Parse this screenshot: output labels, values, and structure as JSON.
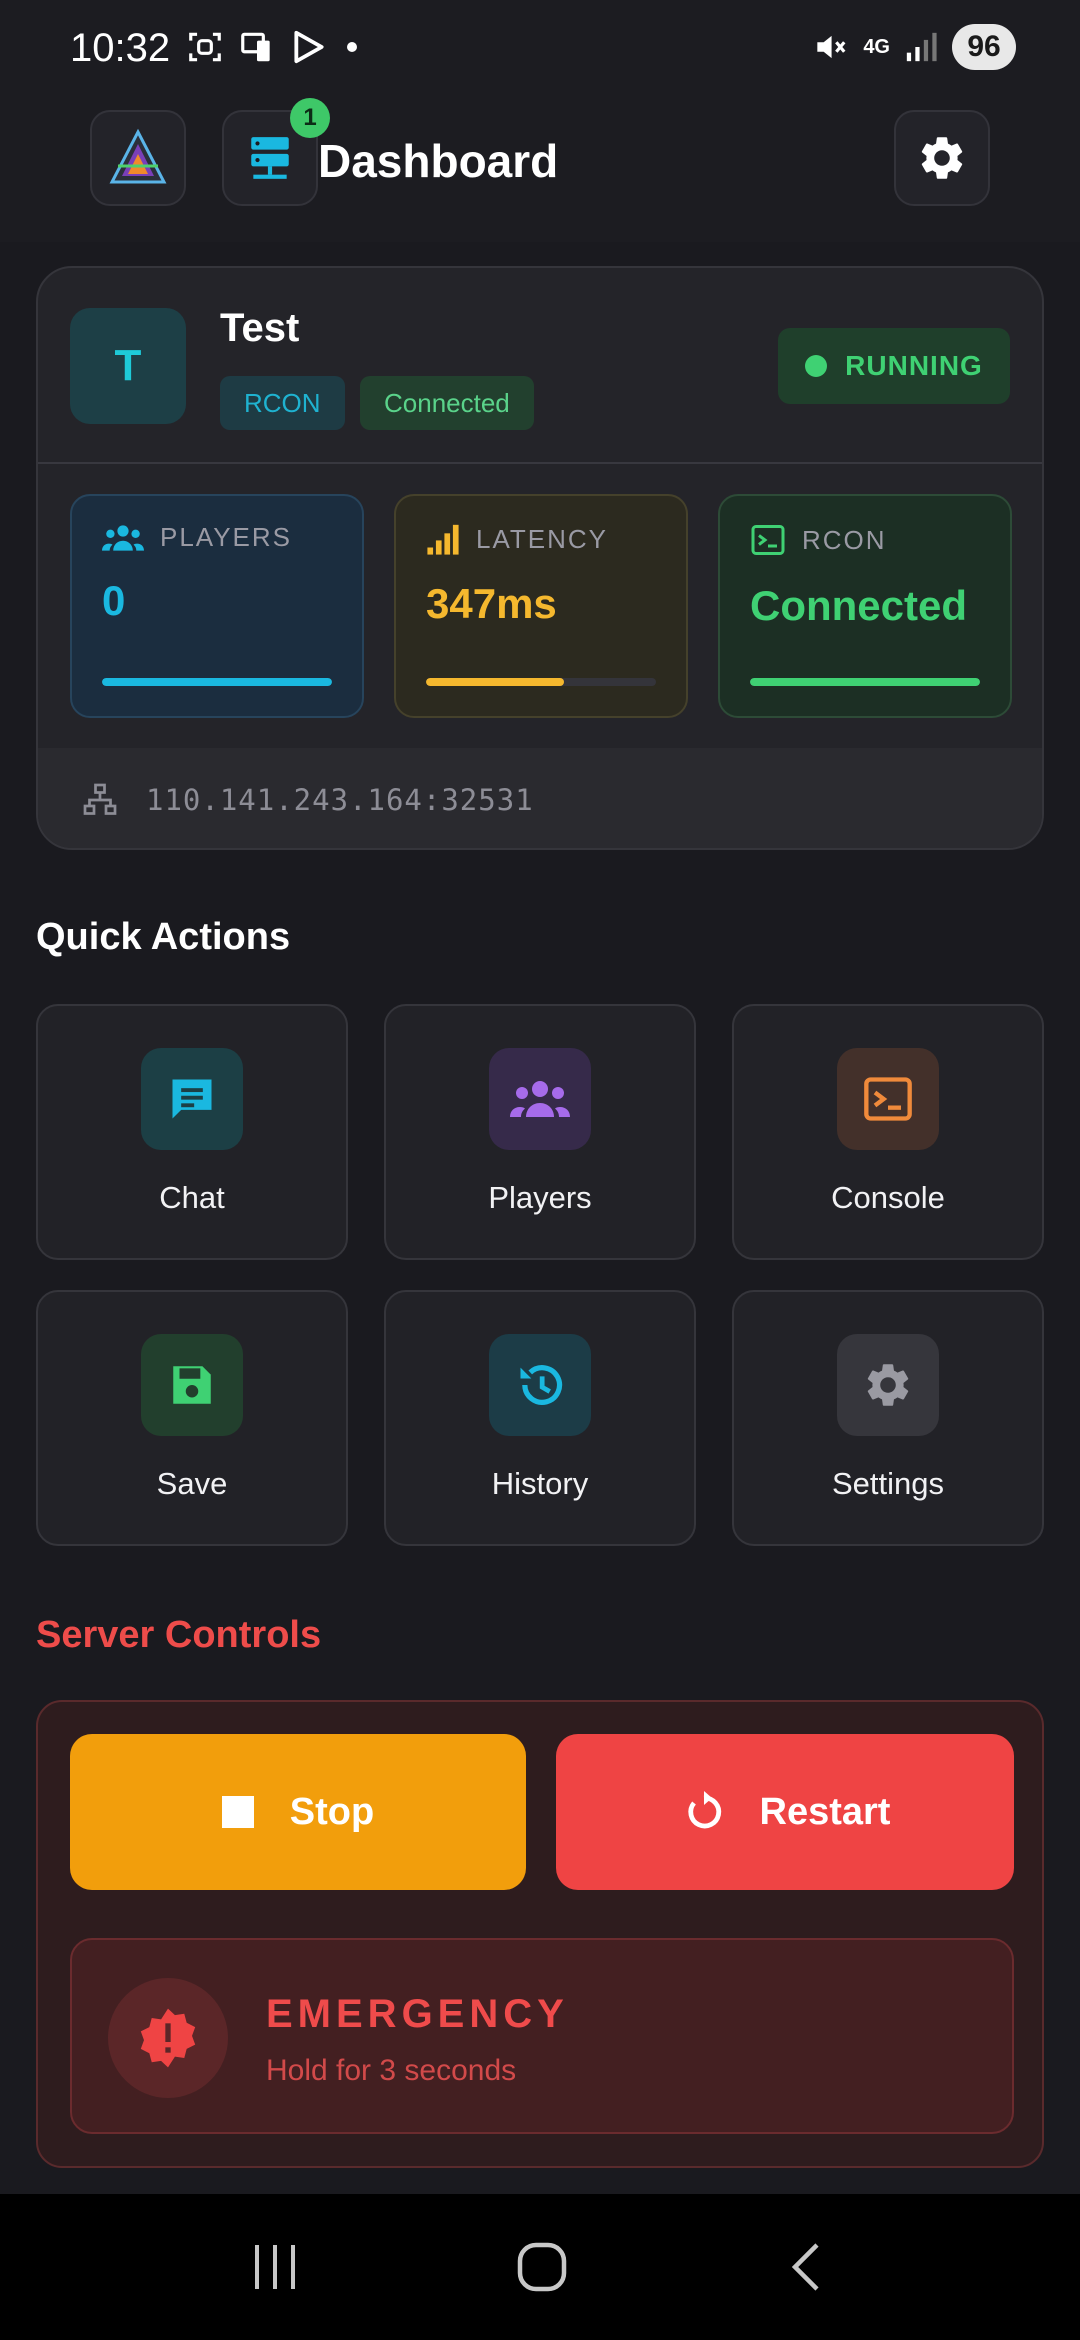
{
  "status_bar": {
    "time": "10:32",
    "network": "4G",
    "battery": "96"
  },
  "header": {
    "title": "Dashboard",
    "notification_count": "1"
  },
  "server": {
    "initial": "T",
    "name": "Test",
    "tags": [
      "RCON",
      "Connected"
    ],
    "status": "RUNNING",
    "address": "110.141.243.164:32531"
  },
  "stats": [
    {
      "label": "PLAYERS",
      "value": "0",
      "color": "#1ab8e0",
      "fill": 1.0
    },
    {
      "label": "LATENCY",
      "value": "347ms",
      "color": "#f5b82e",
      "fill": 0.6
    },
    {
      "label": "RCON",
      "value": "Connected",
      "color": "#3fd173",
      "fill": 1.0
    }
  ],
  "quick_actions": {
    "title": "Quick Actions",
    "items": [
      {
        "label": "Chat",
        "icon": "chat-icon"
      },
      {
        "label": "Players",
        "icon": "players-icon"
      },
      {
        "label": "Console",
        "icon": "console-icon"
      },
      {
        "label": "Save",
        "icon": "save-icon"
      },
      {
        "label": "History",
        "icon": "history-icon"
      },
      {
        "label": "Settings",
        "icon": "settings-icon"
      }
    ]
  },
  "server_controls": {
    "title": "Server Controls",
    "stop_label": "Stop",
    "restart_label": "Restart",
    "emergency_title": "EMERGENCY",
    "emergency_hint": "Hold for 3 seconds"
  },
  "colors": {
    "accent_cyan": "#1ab8e0",
    "running_green": "#3fd173",
    "stop_orange": "#f29e0c",
    "restart_red": "#ef4444",
    "danger_title": "#ee4c4a"
  }
}
